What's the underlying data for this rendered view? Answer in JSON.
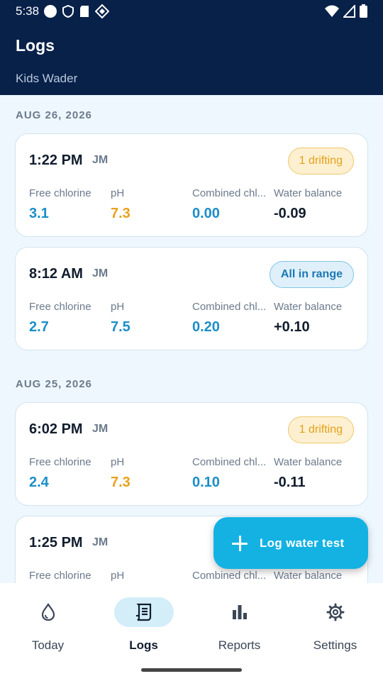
{
  "status_bar": {
    "time": "5:38"
  },
  "header": {
    "title": "Logs",
    "subtitle": "Kids Wader"
  },
  "sections": [
    {
      "date": "AUG 26, 2026",
      "entries": [
        {
          "time": "1:22 PM",
          "initials": "JM",
          "badge": "1 drifting",
          "metrics": [
            {
              "label": "Free chlorine",
              "value": "3.1"
            },
            {
              "label": "pH",
              "value": "7.3"
            },
            {
              "label": "Combined chl...",
              "value": "0.00"
            },
            {
              "label": "Water balance",
              "value": "-0.09"
            }
          ]
        },
        {
          "time": "8:12 AM",
          "initials": "JM",
          "badge": "All in range",
          "metrics": [
            {
              "label": "Free chlorine",
              "value": "2.7"
            },
            {
              "label": "pH",
              "value": "7.5"
            },
            {
              "label": "Combined chl...",
              "value": "0.20"
            },
            {
              "label": "Water balance",
              "value": "+0.10"
            }
          ]
        }
      ]
    },
    {
      "date": "AUG 25, 2026",
      "entries": [
        {
          "time": "6:02 PM",
          "initials": "JM",
          "badge": "1 drifting",
          "metrics": [
            {
              "label": "Free chlorine",
              "value": "2.4"
            },
            {
              "label": "pH",
              "value": "7.3"
            },
            {
              "label": "Combined chl...",
              "value": "0.10"
            },
            {
              "label": "Water balance",
              "value": "-0.11"
            }
          ]
        },
        {
          "time": "1:25 PM",
          "initials": "JM",
          "metrics": [
            {
              "label": "Free chlorine"
            },
            {
              "label": "pH"
            },
            {
              "label": "Combined chl..."
            },
            {
              "label": "Water balance"
            }
          ]
        }
      ]
    }
  ],
  "fab": {
    "label": "Log water test",
    "icon": "plus-icon"
  },
  "nav": [
    {
      "label": "Today",
      "icon": "water-drop-icon"
    },
    {
      "label": "Logs",
      "icon": "logbook-icon",
      "active": true
    },
    {
      "label": "Reports",
      "icon": "bar-chart-icon"
    },
    {
      "label": "Settings",
      "icon": "gear-icon"
    }
  ],
  "colors": {
    "header_bg": "#082149",
    "accent": "#13b2e3",
    "in_range": "#1b8ec8",
    "drifting": "#e8a11a"
  }
}
